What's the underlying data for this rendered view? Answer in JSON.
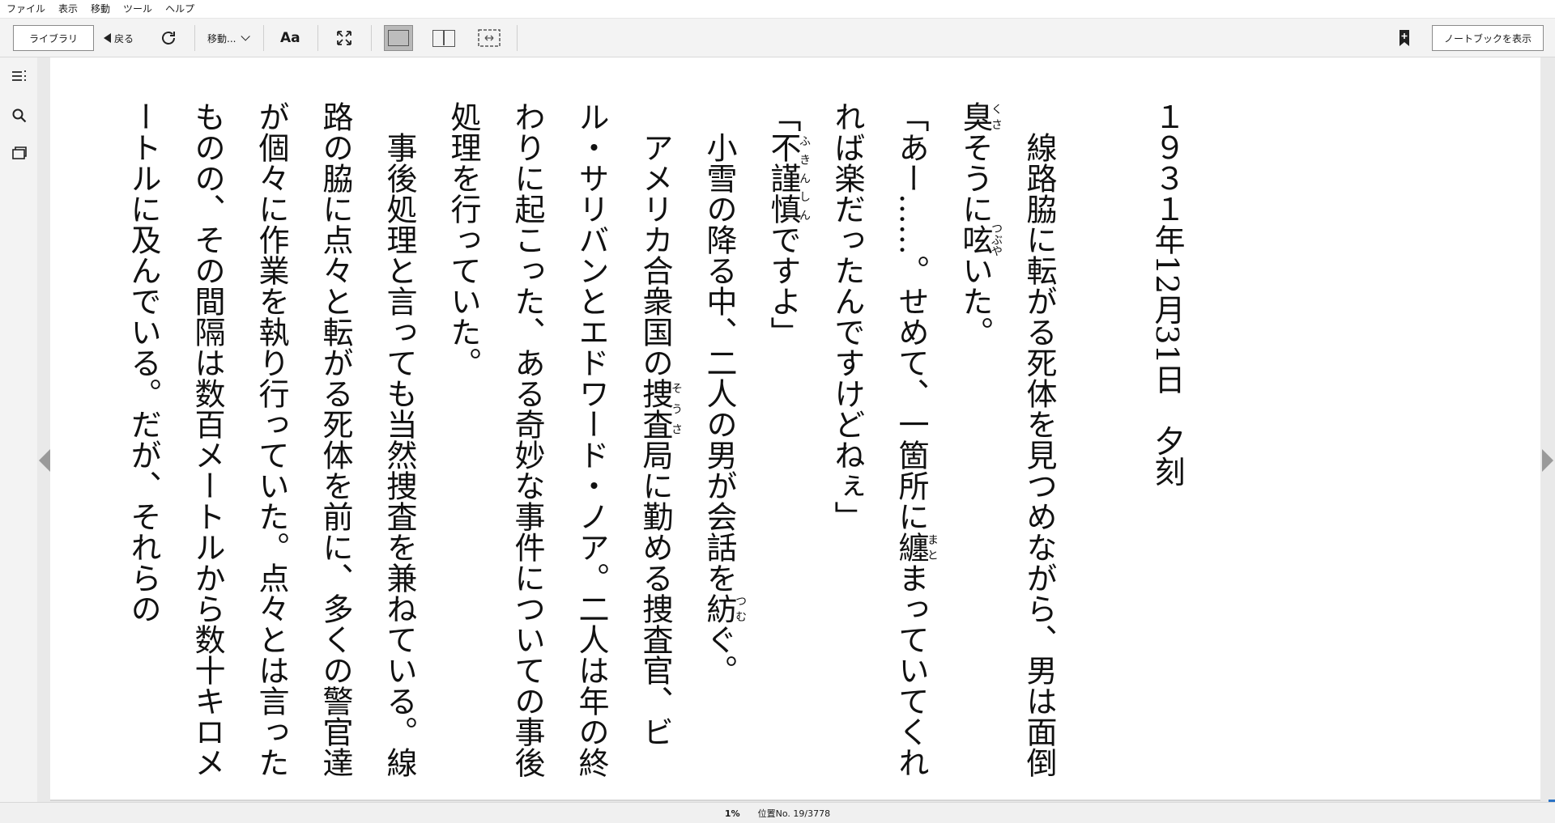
{
  "menubar": {
    "items": [
      "ファイル",
      "表示",
      "移動",
      "ツール",
      "ヘルプ"
    ]
  },
  "toolbar": {
    "library_label": "ライブラリ",
    "back_label": "戻る",
    "move_label": "移動...",
    "font_label": "Aa",
    "notebook_label": "ノートブックを表示",
    "icons": [
      "refresh-icon",
      "fullscreen-icon",
      "single-page-icon",
      "two-page-icon",
      "scroll-view-icon",
      "bookmark-icon"
    ]
  },
  "sidebar": {
    "icons": [
      "table-of-contents-icon",
      "search-icon",
      "flashcards-icon"
    ]
  },
  "book": {
    "heading": "１９３１年12月31日　夕刻",
    "paragraphs": [
      "線路脇に転がる死体を見つめながら、男は面倒臭そうに呟いた。",
      "「あー……。せめて、一箇所に纏まっていてくれれば楽だったんですけどねぇ」",
      "「不謹慎ですよ」",
      "小雪の降る中、二人の男が会話を紡ぐ。",
      "アメリカ合衆国の捜査局に勤める捜査官、ビル・サリバンとエドワード・ノア。二人は年の終わりに起こった、ある奇妙な事件についての事後処理を行っていた。",
      "事後処理と言っても当然捜査を兼ねている。線路の脇に点々と転がる死体を前に、多くの警官達が個々に作業を執り行っていた。点々とは言ったものの、その間隔は数百メートルから数十キロメートルに及んでいる。だが、それらの"
    ],
    "ruby": {
      "kusa": "くさ",
      "tsubuya": "つぶや",
      "mato": "まと",
      "fukinshin": "ふきんしん",
      "tsumu": "つむ",
      "sousa": "そうさ"
    }
  },
  "statusbar": {
    "progress_label": "1%",
    "location_label": "位置No. 19/3778"
  },
  "progress": 0.01,
  "colors": {
    "accent": "#2a73c5",
    "page": "#ffffff",
    "chrome": "#f3f3f3"
  }
}
